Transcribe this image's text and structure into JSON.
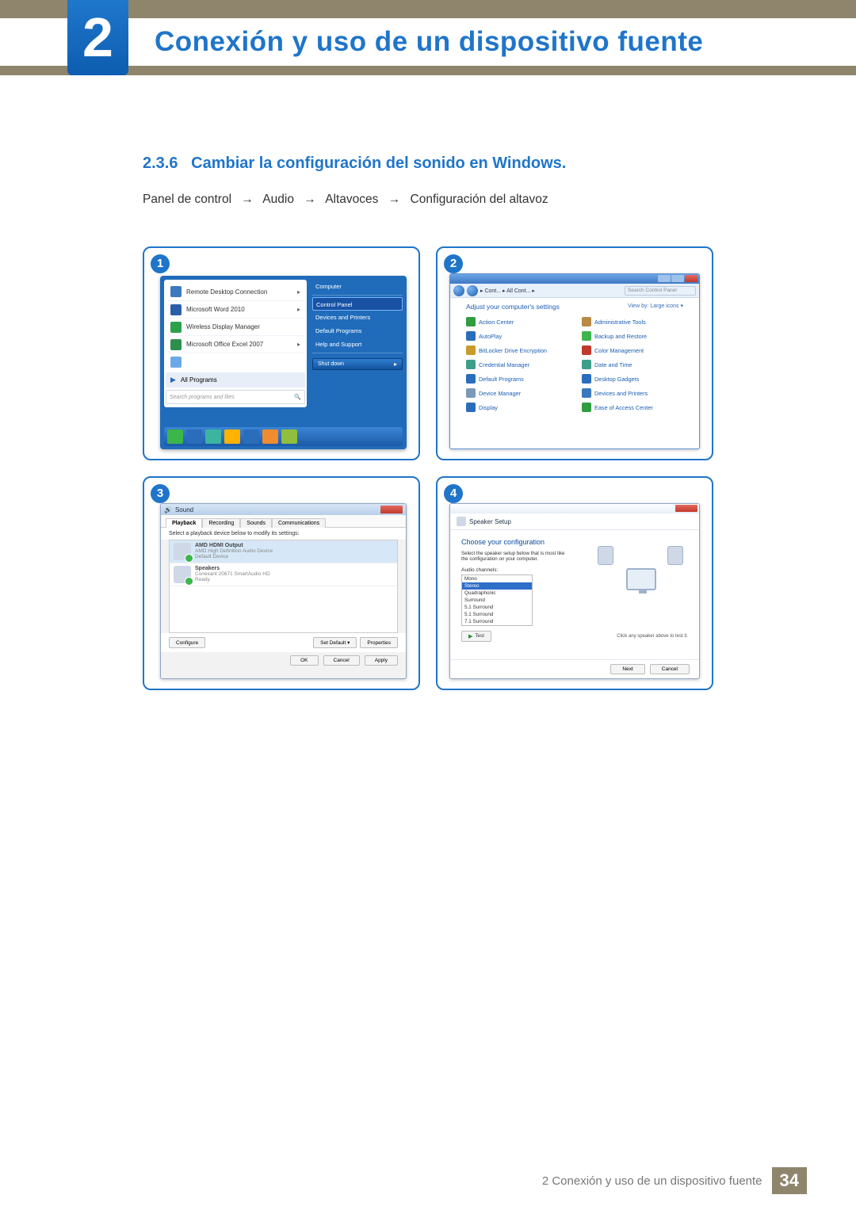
{
  "header": {
    "chapter_number": "2",
    "chapter_title": "Conexión y uso de un dispositivo fuente"
  },
  "section": {
    "number": "2.3.6",
    "title": "Cambiar la configuración del sonido en Windows."
  },
  "breadcrumb": {
    "p1": "Panel de control",
    "p2": "Audio",
    "p3": "Altavoces",
    "p4": "Configuración del altavoz",
    "arrow": "→"
  },
  "steps": {
    "s1": "1",
    "s2": "2",
    "s3": "3",
    "s4": "4"
  },
  "step1": {
    "items": [
      {
        "label": "Remote Desktop Connection",
        "chev": "▸",
        "color": "#3b7abf"
      },
      {
        "label": "Microsoft Word 2010",
        "chev": "▸",
        "color": "#2a5ea9"
      },
      {
        "label": "Wireless Display Manager",
        "chev": "",
        "color": "#2da14a"
      },
      {
        "label": "Microsoft Office Excel 2007",
        "chev": "▸",
        "color": "#2e8f4d"
      },
      {
        "label": "",
        "chev": "",
        "color": "#6aa9e6"
      }
    ],
    "all_programs": "All Programs",
    "search_placeholder": "Search programs and files",
    "right": {
      "top": [
        "Computer"
      ],
      "group": [
        "Control Panel",
        "Devices and Printers",
        "Default Programs",
        "Help and Support"
      ],
      "shutdown": "Shut down"
    },
    "taskbar_colors": [
      "#3cb54a",
      "#2a6dbb",
      "#3cb5a0",
      "#ffb300",
      "#2a6dbb",
      "#f08c2e",
      "#8fbf3c"
    ]
  },
  "step2": {
    "crumb": "▸ Cont... ▸  All Cont...  ▸",
    "search_ph": "Search Control Panel",
    "head": "Adjust your computer's settings",
    "view": "View by:   Large icons ▾",
    "items_l": [
      {
        "t": "Action Center",
        "c": "#2f9e3f"
      },
      {
        "t": "AutoPlay",
        "c": "#2a6dbb"
      },
      {
        "t": "BitLocker Drive Encryption",
        "c": "#c79b2c"
      },
      {
        "t": "Credential Manager",
        "c": "#3c9e8a"
      },
      {
        "t": "Default Programs",
        "c": "#2a6dbb"
      },
      {
        "t": "Device Manager",
        "c": "#7a99b8"
      },
      {
        "t": "Display",
        "c": "#2a6dbb"
      }
    ],
    "items_r": [
      {
        "t": "Administrative Tools",
        "c": "#b88a47"
      },
      {
        "t": "Backup and Restore",
        "c": "#3cb54a"
      },
      {
        "t": "Color Management",
        "c": "#c1392b"
      },
      {
        "t": "Date and Time",
        "c": "#3c9e8a"
      },
      {
        "t": "Desktop Gadgets",
        "c": "#2a6dbb"
      },
      {
        "t": "Devices and Printers",
        "c": "#3a78bf"
      },
      {
        "t": "Ease of Access Center",
        "c": "#2f9e3f"
      }
    ]
  },
  "step3": {
    "title": "Sound",
    "tabs": [
      "Playback",
      "Recording",
      "Sounds",
      "Communications"
    ],
    "instruction": "Select a playback device below to modify its settings:",
    "devices": [
      {
        "n": "AMD HDMI Output",
        "d": "AMD High Definition Audio Device",
        "s": "Default Device",
        "sel": true
      },
      {
        "n": "Speakers",
        "d": "Conexant 20671 SmartAudio HD",
        "s": "Ready",
        "sel": false
      }
    ],
    "configure": "Configure",
    "set_default": "Set Default ▾",
    "properties": "Properties",
    "ok": "OK",
    "cancel": "Cancel",
    "apply": "Apply"
  },
  "step4": {
    "title": "Speaker Setup",
    "heading": "Choose your configuration",
    "desc": "Select the speaker setup below that is most like the configuration on your computer.",
    "channels_label": "Audio channels:",
    "options": [
      "Mono",
      "Stereo",
      "Quadraphonic",
      "Surround",
      "5.1 Surround",
      "5.1 Surround",
      "7.1 Surround"
    ],
    "selected_index": 1,
    "test": "Test",
    "hint": "Click any speaker above to test it.",
    "next": "Next",
    "cancel": "Cancel"
  },
  "footer": {
    "text": "2 Conexión y uso de un dispositivo fuente",
    "page": "34"
  }
}
